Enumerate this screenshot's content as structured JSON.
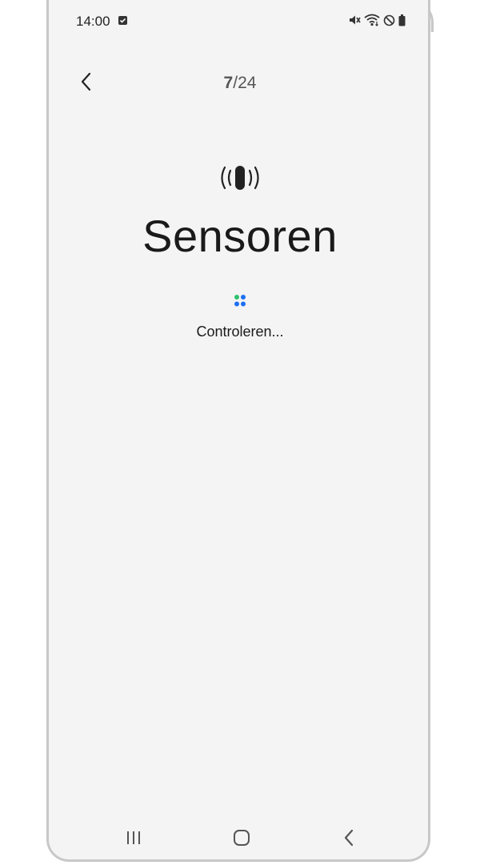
{
  "status_bar": {
    "time": "14:00",
    "icons": [
      "checkbox-notification-icon",
      "mute-icon",
      "wifi-icon",
      "do-not-disturb-icon",
      "battery-icon"
    ]
  },
  "header": {
    "current_page": "7",
    "total_pages": "/24",
    "back_icon": "chevron-left-icon"
  },
  "main": {
    "icon": "vibration-sensor-icon",
    "title": "Sensoren",
    "status": "Controleren..."
  },
  "nav_bar": {
    "recents_icon": "recents-icon",
    "home_icon": "home-icon",
    "back_icon": "back-icon"
  },
  "colors": {
    "background": "#f4f4f4",
    "spinner_blue": "#1e6ff1",
    "spinner_green": "#2fbf71",
    "text": "#1a1a1a"
  }
}
